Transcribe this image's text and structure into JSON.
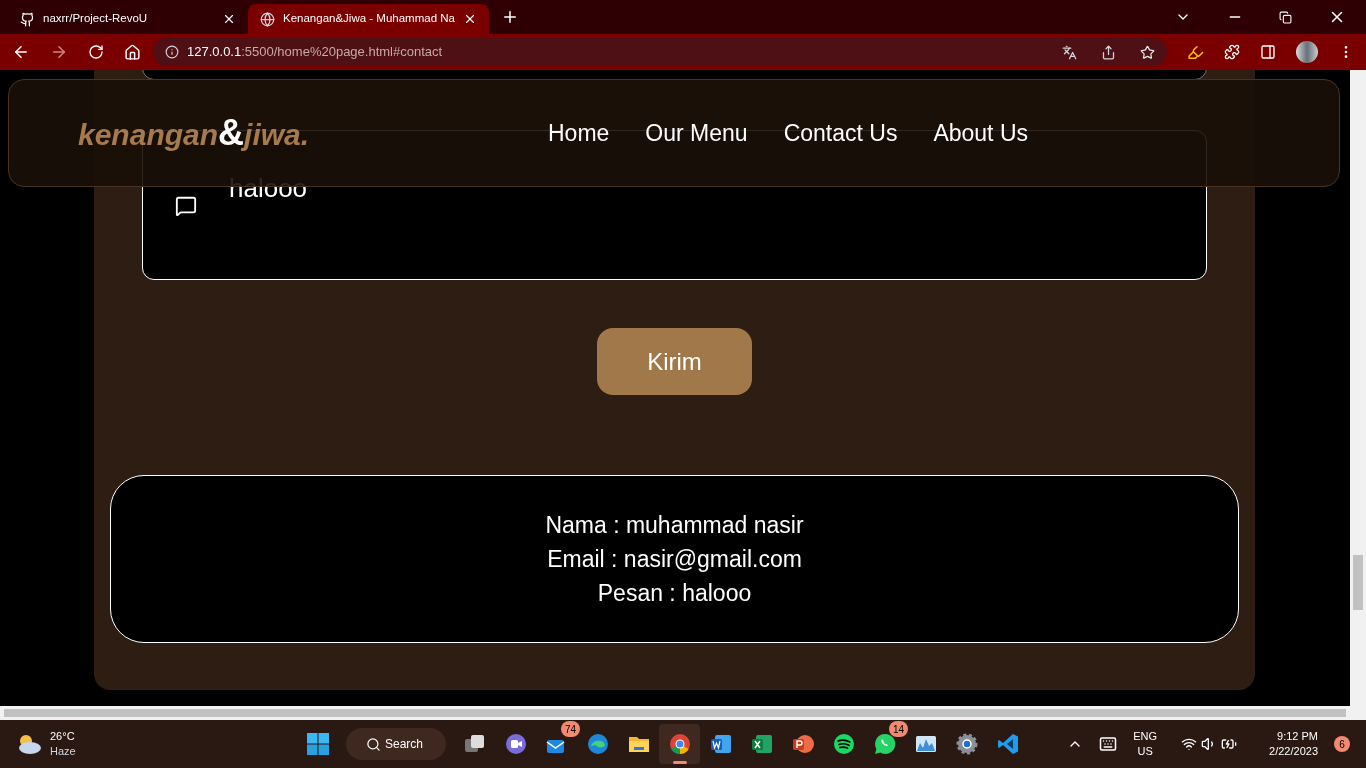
{
  "browser": {
    "tabs": [
      {
        "title": "naxrr/Project-RevoU",
        "kind": "github",
        "selected": false
      },
      {
        "title": "Kenangan&Jiwa - Muhammad Na",
        "kind": "globe",
        "selected": true
      }
    ],
    "address": {
      "host": "127.0.0.1",
      "rest": ":5500/home%20page.html#contact"
    }
  },
  "navbar": {
    "logo": [
      {
        "text": "kenangan",
        "accent": false
      },
      {
        "text": "&",
        "accent": true
      },
      {
        "text": "jiwa.",
        "accent": false
      }
    ],
    "links": [
      "Home",
      "Our Menu",
      "Contact Us",
      "About Us"
    ]
  },
  "form": {
    "message": "halooo",
    "submit": "Kirim"
  },
  "result": [
    "Nama : muhammad nasir",
    "Email : nasir@gmail.com",
    "Pesan : halooo"
  ],
  "taskbar": {
    "weather": {
      "temp": "26°C",
      "condition": "Haze"
    },
    "search": "Search",
    "apps": [
      {
        "kind": "taskview",
        "active": false
      },
      {
        "kind": "teams",
        "active": false
      },
      {
        "kind": "mail",
        "badge": "74",
        "active": false
      },
      {
        "kind": "edge",
        "active": false
      },
      {
        "kind": "explorer",
        "active": false
      },
      {
        "kind": "chrome",
        "active": true
      },
      {
        "kind": "word",
        "active": false
      },
      {
        "kind": "excel",
        "active": false
      },
      {
        "kind": "powerpoint",
        "active": false
      },
      {
        "kind": "spotify",
        "active": false
      },
      {
        "kind": "whatsapp",
        "badge": "14",
        "active": false
      },
      {
        "kind": "monitor",
        "active": false
      },
      {
        "kind": "settings",
        "active": false
      },
      {
        "kind": "vscode",
        "active": false
      }
    ],
    "language": [
      "ENG",
      "US"
    ],
    "time": "9:12 PM",
    "date": "2/22/2023",
    "notifications": "6"
  }
}
